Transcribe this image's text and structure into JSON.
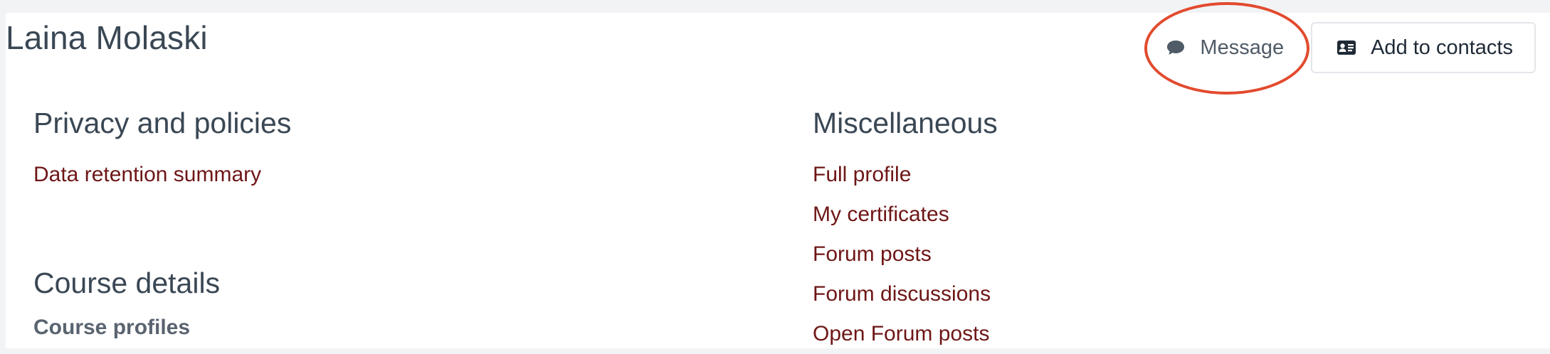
{
  "user": {
    "name": "Laina Molaski"
  },
  "actions": {
    "message_label": "Message",
    "add_contacts_label": "Add to contacts"
  },
  "sections": {
    "privacy": {
      "title": "Privacy and policies",
      "links": [
        "Data retention summary"
      ]
    },
    "course": {
      "title": "Course details",
      "subheading": "Course profiles"
    },
    "misc": {
      "title": "Miscellaneous",
      "links": [
        "Full profile",
        "My certificates",
        "Forum posts",
        "Forum discussions",
        "Open Forum posts"
      ]
    }
  },
  "colors": {
    "link": "#6e1616",
    "heading": "#3a4754",
    "annotation": "#e24a2e",
    "background": "#f2f3f5"
  },
  "icons": {
    "message": "speech-bubble-icon",
    "contacts": "address-card-icon"
  }
}
